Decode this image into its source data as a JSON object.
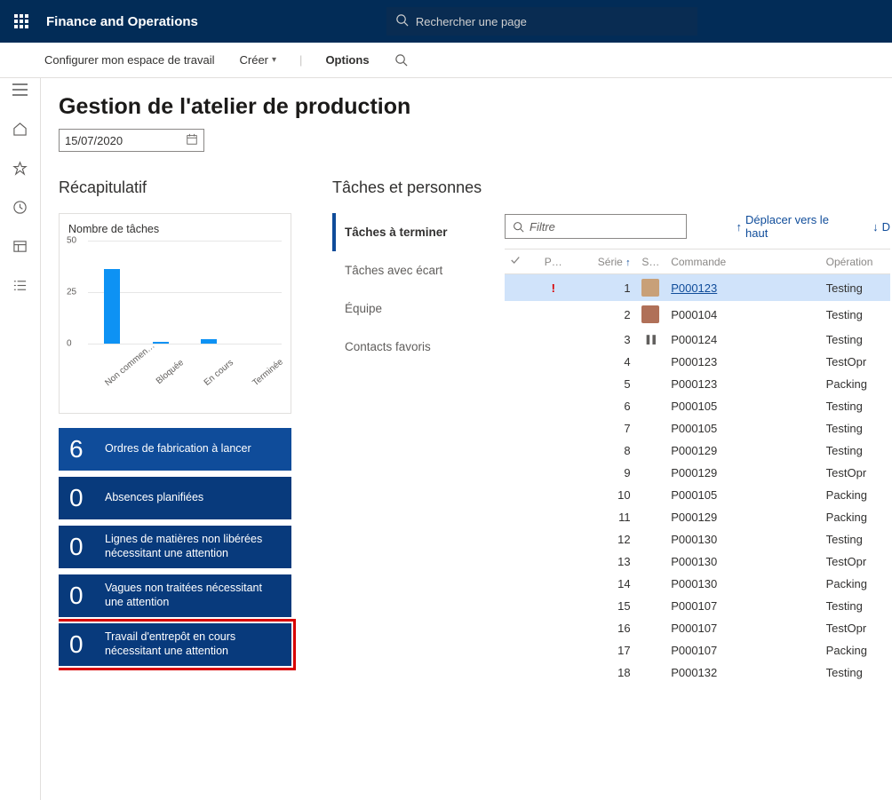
{
  "header": {
    "brand": "Finance and Operations",
    "search_placeholder": "Rechercher une page"
  },
  "command_bar": {
    "configure": "Configurer mon espace de travail",
    "create": "Créer",
    "options": "Options"
  },
  "page": {
    "title": "Gestion de l'atelier de production",
    "date_value": "15/07/2020"
  },
  "summary": {
    "heading": "Récapitulatif",
    "chart_title": "Nombre de tâches"
  },
  "chart_data": {
    "type": "bar",
    "categories": [
      "Non commen…",
      "Bloquée",
      "En cours",
      "Terminée"
    ],
    "values": [
      36,
      1,
      2,
      0
    ],
    "y_ticks": [
      0,
      25,
      50
    ],
    "ylim": [
      0,
      50
    ],
    "title": "Nombre de tâches"
  },
  "tiles": [
    {
      "count": "6",
      "label": "Ordres de fabrication à lancer",
      "variant": "light",
      "highlight": false
    },
    {
      "count": "0",
      "label": "Absences planifiées",
      "variant": "dark",
      "highlight": false
    },
    {
      "count": "0",
      "label": "Lignes de matières non libérées nécessitant une attention",
      "variant": "dark",
      "highlight": false
    },
    {
      "count": "0",
      "label": "Vagues non traitées nécessitant une attention",
      "variant": "dark",
      "highlight": false
    },
    {
      "count": "0",
      "label": "Travail d'entrepôt en cours nécessitant une attention",
      "variant": "dark",
      "highlight": true
    }
  ],
  "tasks_panel": {
    "heading": "Tâches et personnes",
    "tabs": [
      {
        "label": "Tâches à terminer",
        "active": true
      },
      {
        "label": "Tâches avec écart",
        "active": false
      },
      {
        "label": "Équipe",
        "active": false
      },
      {
        "label": "Contacts favoris",
        "active": false
      }
    ],
    "filter_placeholder": "Filtre",
    "actions": {
      "move_up": "Déplacer vers le haut",
      "move_down": "D"
    },
    "columns": {
      "p": "P…",
      "serie": "Série",
      "s": "S…",
      "commande": "Commande",
      "operation": "Opération"
    },
    "rows": [
      {
        "priority": "!",
        "serie": 1,
        "status": "avatar-a",
        "commande": "P000123",
        "operation": "Testing",
        "selected": true
      },
      {
        "priority": "",
        "serie": 2,
        "status": "avatar-b",
        "commande": "P000104",
        "operation": "Testing",
        "selected": false
      },
      {
        "priority": "",
        "serie": 3,
        "status": "pause",
        "commande": "P000124",
        "operation": "Testing",
        "selected": false
      },
      {
        "priority": "",
        "serie": 4,
        "status": "",
        "commande": "P000123",
        "operation": "TestOpr",
        "selected": false
      },
      {
        "priority": "",
        "serie": 5,
        "status": "",
        "commande": "P000123",
        "operation": "Packing",
        "selected": false
      },
      {
        "priority": "",
        "serie": 6,
        "status": "",
        "commande": "P000105",
        "operation": "Testing",
        "selected": false
      },
      {
        "priority": "",
        "serie": 7,
        "status": "",
        "commande": "P000105",
        "operation": "Testing",
        "selected": false
      },
      {
        "priority": "",
        "serie": 8,
        "status": "",
        "commande": "P000129",
        "operation": "Testing",
        "selected": false
      },
      {
        "priority": "",
        "serie": 9,
        "status": "",
        "commande": "P000129",
        "operation": "TestOpr",
        "selected": false
      },
      {
        "priority": "",
        "serie": 10,
        "status": "",
        "commande": "P000105",
        "operation": "Packing",
        "selected": false
      },
      {
        "priority": "",
        "serie": 11,
        "status": "",
        "commande": "P000129",
        "operation": "Packing",
        "selected": false
      },
      {
        "priority": "",
        "serie": 12,
        "status": "",
        "commande": "P000130",
        "operation": "Testing",
        "selected": false
      },
      {
        "priority": "",
        "serie": 13,
        "status": "",
        "commande": "P000130",
        "operation": "TestOpr",
        "selected": false
      },
      {
        "priority": "",
        "serie": 14,
        "status": "",
        "commande": "P000130",
        "operation": "Packing",
        "selected": false
      },
      {
        "priority": "",
        "serie": 15,
        "status": "",
        "commande": "P000107",
        "operation": "Testing",
        "selected": false
      },
      {
        "priority": "",
        "serie": 16,
        "status": "",
        "commande": "P000107",
        "operation": "TestOpr",
        "selected": false
      },
      {
        "priority": "",
        "serie": 17,
        "status": "",
        "commande": "P000107",
        "operation": "Packing",
        "selected": false
      },
      {
        "priority": "",
        "serie": 18,
        "status": "",
        "commande": "P000132",
        "operation": "Testing",
        "selected": false
      }
    ]
  }
}
